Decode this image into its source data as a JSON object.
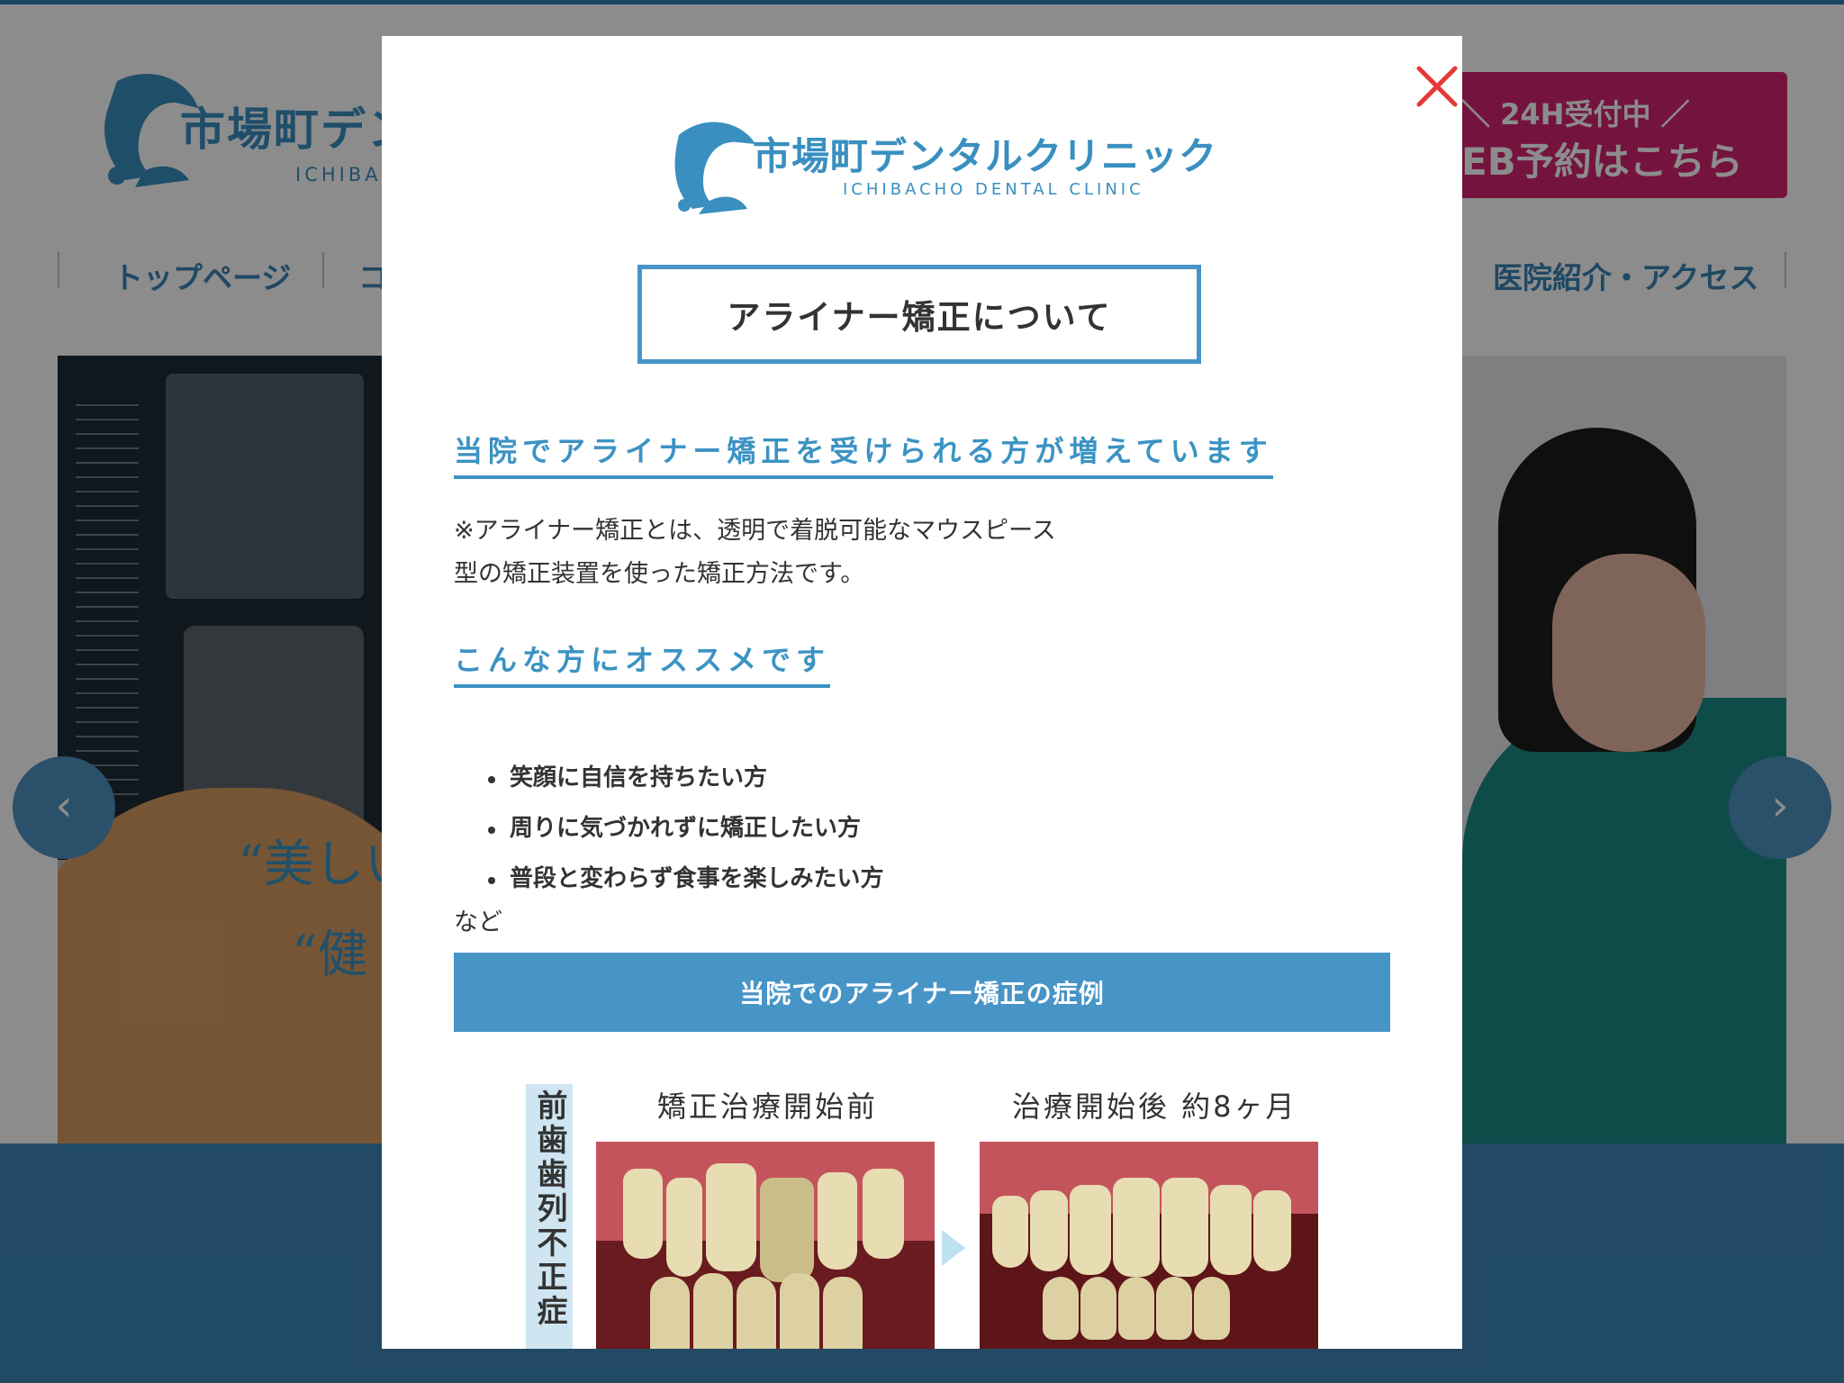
{
  "background_page": {
    "clinic_name": "市場町デンタルクリニック",
    "clinic_name_visible": "市場町デン",
    "clinic_sub": "ICHIBAC",
    "reserve_line1": "＼ 24H受付中 ／",
    "reserve_line2": "WEB予約はこちら",
    "reserve_line1_visible": "＼ 24H受付中 ／",
    "reserve_line2_visible": "EB予約はこちら",
    "nav": {
      "top": "トップページ",
      "second_visible": "コ",
      "access": "医院紹介・アクセス"
    },
    "hero_copy1_visible": "“美しい",
    "hero_copy2_visible": "“健",
    "colors": {
      "brand_blue": "#3a8fc0",
      "reserve_pink": "#d42572",
      "wave": "#3e88b8"
    }
  },
  "carousel": {
    "prev_icon": "chevron-left-icon",
    "next_icon": "chevron-right-icon",
    "prev_glyph": "‹",
    "next_glyph": "›"
  },
  "modal": {
    "close_icon": "close-icon",
    "logo_title": "市場町デンタルクリニック",
    "logo_sub": "ICHIBACHO DENTAL CLINIC",
    "title": "アライナー矯正について",
    "heading1": "当院でアライナー矯正を受けられる方が増えています",
    "paragraph_line1": "※アライナー矯正とは、透明で着脱可能なマウスピース",
    "paragraph_line2": "型の矯正装置を使った矯正方法です。",
    "heading2": "こんな方にオススメです",
    "bullets": [
      "笑顔に自信を持ちたい方",
      "周りに気づかれずに矯正したい方",
      "普段と変わらず食事を楽しみたい方"
    ],
    "etc": "など",
    "cases_button": "当院でのアライナー矯正の症例",
    "case": {
      "vertical_label": "前歯歯列不正症",
      "before_caption": "矯正治療開始前",
      "after_caption": "治療開始後 約8ヶ月"
    },
    "colors": {
      "accent": "#4794c7",
      "heading": "#3b93c3",
      "close": "#e53935"
    }
  }
}
